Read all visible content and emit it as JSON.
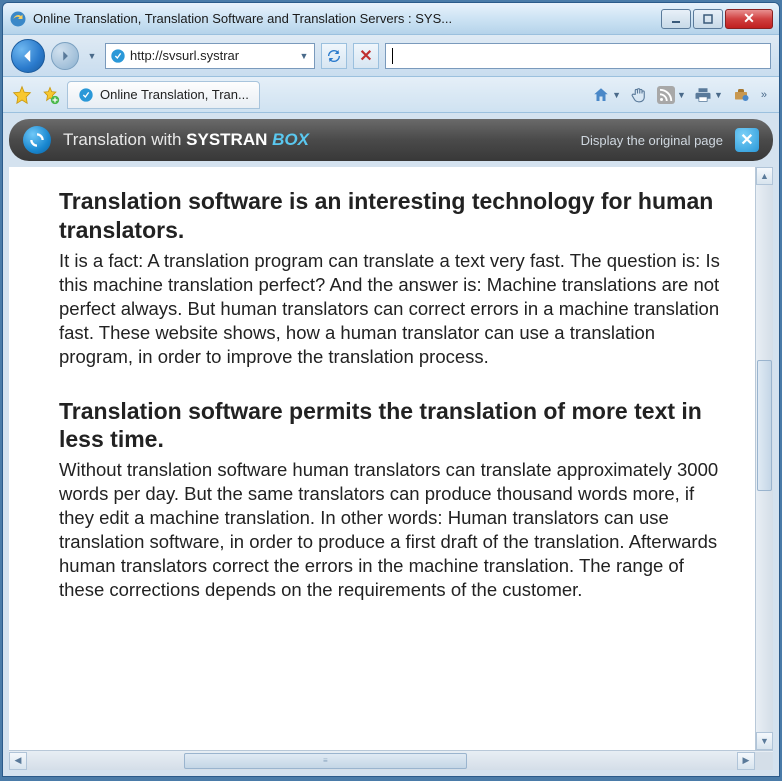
{
  "window": {
    "title": "Online Translation, Translation Software and Translation Servers : SYS..."
  },
  "nav": {
    "url": "http://svsurl.systrar"
  },
  "tab": {
    "label": "Online Translation, Tran..."
  },
  "systran": {
    "prefix": "Translation with ",
    "brand": "SYSTRAN ",
    "suffix": "BOX",
    "link": "Display the original page"
  },
  "article": {
    "h1": "Translation software is an interesting technology for human translators.",
    "p1": "It is a fact: A translation program can translate a text very fast. The question is: Is this machine translation perfect? And the answer is: Machine translations are not perfect always. But human translators can correct errors in a machine translation fast. These website shows, how a human translator can use a translation program, in order to improve the translation process.",
    "h2": "Translation software permits the translation of more text in less time.",
    "p2": "Without translation software human translators can translate approximately 3000 words per day. But the same translators can produce thousand words more, if they edit a machine translation. In other words: Human translators can use translation software, in order to produce a first draft of the translation. Afterwards human translators correct the errors in the machine translation. The range of these corrections depends on the requirements of the customer."
  }
}
